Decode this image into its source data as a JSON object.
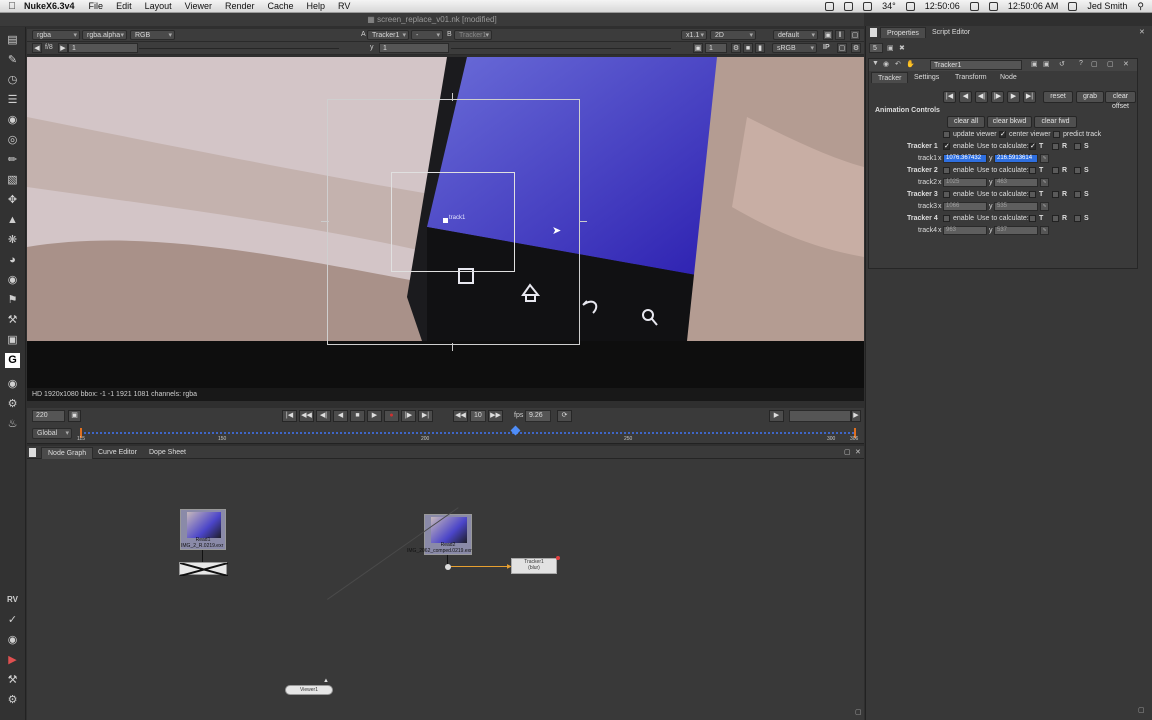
{
  "menubar": {
    "app": "NukeX6.3v4",
    "items": [
      "File",
      "Edit",
      "Layout",
      "Viewer",
      "Render",
      "Cache",
      "Help",
      "RV"
    ],
    "temp": "34°",
    "time_small": "12:50:06",
    "clock": "12:50:06 AM",
    "user": "Jed Smith"
  },
  "window": {
    "title": "screen_replace_v01.nk [modified]"
  },
  "viewer": {
    "channels": "rgba",
    "alpha": "rgba.alpha",
    "display_channels": "RGB",
    "a_label": "A",
    "a_input": "Tracker1",
    "ab_dash": "-",
    "b_label": "B",
    "b_input": "Tracker1",
    "zoom": "x1.1",
    "view_mode": "2D",
    "lut": "default",
    "frame_step": "f/8",
    "frame_step_value": "1",
    "y_label": "y",
    "y_value": "1",
    "exposure_value": "1",
    "gamma_value": "1",
    "colorspace": "sRGB",
    "ip_label": "IP",
    "track_point_label": "track1",
    "info": "HD 1920x1080  bbox: -1 -1 1921 1081 channels: rgba"
  },
  "playback": {
    "current_frame": "220",
    "increment": "10",
    "fps_label": "fps",
    "fps": "9.26",
    "range_mode": "Global",
    "ticks": [
      "115",
      "150",
      "200",
      "250",
      "300",
      "306"
    ],
    "cursor_frame_fraction": 0.56
  },
  "nodegraph": {
    "tabs": [
      "Node Graph",
      "Curve Editor",
      "Dope Sheet"
    ],
    "nodes": {
      "read1": {
        "name": "Read1",
        "sub": "IMG_2_R.0219.exr"
      },
      "read2": {
        "name": "Read2",
        "sub": "IMG_2062_comped.0219.exr"
      },
      "tracker": {
        "name": "Tracker1",
        "sub": "(blur)"
      },
      "viewer": {
        "name": "Viewer1"
      }
    }
  },
  "properties": {
    "tabs": [
      "Properties",
      "Script Editor"
    ],
    "max_panels": "5",
    "node_name": "Tracker1",
    "node_tabs": [
      "Tracker",
      "Settings",
      "Transform",
      "Node"
    ],
    "top_buttons": [
      "reset",
      "grab",
      "clear offset"
    ],
    "section": "Animation Controls",
    "clear_buttons": [
      "clear all",
      "clear bkwd",
      "clear fwd"
    ],
    "options": [
      "update viewer",
      "center viewer",
      "predict track"
    ],
    "enable_label": "enable",
    "use_calc_label": "Use to calculate:",
    "calc_flags": [
      "T",
      "R",
      "S"
    ],
    "x_label": "x",
    "y_label": "y",
    "anim_icon": "animation-menu-icon",
    "trackers": [
      {
        "label": "Tracker 1",
        "track": "track1",
        "x": "1076.367432",
        "y": "216.5913614",
        "enabled": true,
        "T": true
      },
      {
        "label": "Tracker 2",
        "track": "track2",
        "x": "1025",
        "y": "463",
        "enabled": false,
        "T": false
      },
      {
        "label": "Tracker 3",
        "track": "track3",
        "x": "1066",
        "y": "535",
        "enabled": false,
        "T": false
      },
      {
        "label": "Tracker 4",
        "track": "track4",
        "x": "963",
        "y": "537",
        "enabled": false,
        "T": false
      }
    ]
  },
  "left_toolbar_label": "RV"
}
